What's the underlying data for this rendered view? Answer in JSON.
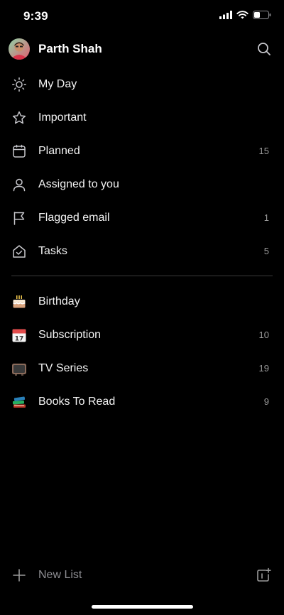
{
  "status_bar": {
    "time": "9:39",
    "icons": [
      "cellular-signal-icon",
      "wifi-icon",
      "battery-icon"
    ]
  },
  "header": {
    "profile_name": "Parth Shah",
    "search_icon": "search-icon"
  },
  "smart_lists": [
    {
      "label": "My Day",
      "icon": "sun-icon",
      "count": ""
    },
    {
      "label": "Important",
      "icon": "star-icon",
      "count": ""
    },
    {
      "label": "Planned",
      "icon": "calendar-icon",
      "count": "15"
    },
    {
      "label": "Assigned to you",
      "icon": "person-icon",
      "count": ""
    },
    {
      "label": "Flagged email",
      "icon": "flag-icon",
      "count": "1"
    },
    {
      "label": "Tasks",
      "icon": "home-check-icon",
      "count": "5"
    }
  ],
  "custom_lists": [
    {
      "label": "Birthday",
      "emoji": "🎂",
      "count": ""
    },
    {
      "label": "Subscription",
      "emoji": "📅",
      "count": "10"
    },
    {
      "label": "TV Series",
      "emoji": "📺",
      "count": "19"
    },
    {
      "label": "Books To Read",
      "emoji": "📚",
      "count": "9"
    }
  ],
  "footer": {
    "new_list_label": "New List"
  },
  "colors": {
    "background": "#000000",
    "text_primary": "#f2f2f2",
    "text_secondary": "#9a9a9a",
    "divider": "#3a3a3c"
  }
}
